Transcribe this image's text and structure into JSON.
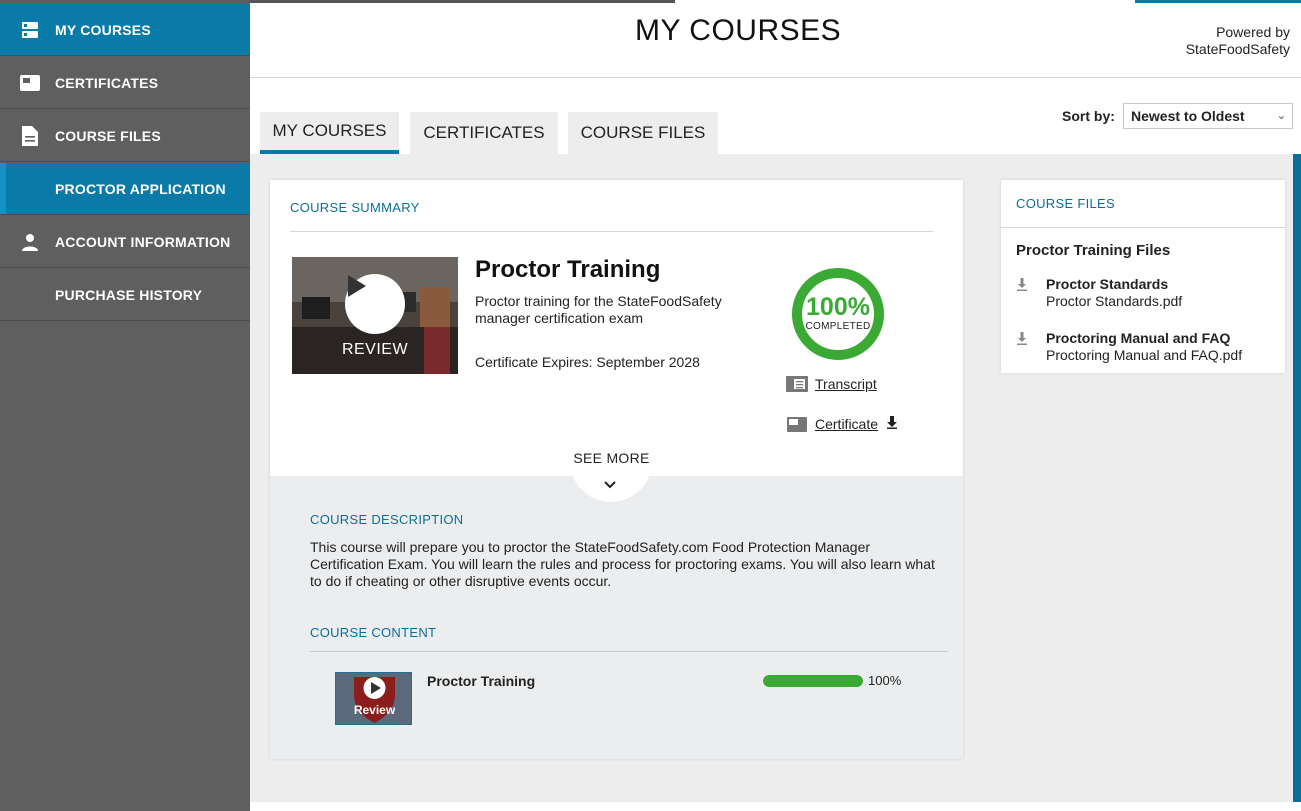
{
  "sidebar": {
    "items": [
      {
        "label": "MY COURSES",
        "icon": "courses-icon"
      },
      {
        "label": "CERTIFICATES",
        "icon": "certificate-card-icon"
      },
      {
        "label": "COURSE FILES",
        "icon": "document-icon"
      },
      {
        "label": "PROCTOR APPLICATION",
        "icon": ""
      },
      {
        "label": "ACCOUNT INFORMATION",
        "icon": "person-icon"
      },
      {
        "label": "PURCHASE HISTORY",
        "icon": ""
      }
    ]
  },
  "header": {
    "title": "MY COURSES",
    "powered_line1": "Powered by",
    "powered_line2": "StateFoodSafety"
  },
  "tabs": [
    {
      "label": "MY COURSES",
      "active": true
    },
    {
      "label": "CERTIFICATES",
      "active": false
    },
    {
      "label": "COURSE FILES",
      "active": false
    }
  ],
  "sort": {
    "label": "Sort by:",
    "value": "Newest to Oldest"
  },
  "course": {
    "summary_label": "COURSE SUMMARY",
    "thumbnail_label": "REVIEW",
    "title": "Proctor Training",
    "subtitle": "Proctor training for the StateFoodSafety manager certification exam",
    "expires": "Certificate Expires: September 2028",
    "progress_percent": "100%",
    "progress_fraction": 1.0,
    "progress_caption": "COMPLETED",
    "transcript_link": "Transcript",
    "certificate_link": "Certificate",
    "see_more": "SEE MORE",
    "description_label": "COURSE DESCRIPTION",
    "description": "This course will prepare you to proctor the StateFoodSafety.com Food Protection Manager Certification Exam. You will learn the rules and process for proctoring exams. You will also learn what to do if cheating or other disruptive events occur.",
    "content_label": "COURSE CONTENT",
    "modules": [
      {
        "title": "Proctor Training",
        "thumb_label": "Review",
        "percent": "100%",
        "fraction": 1.0
      }
    ]
  },
  "files": {
    "label": "COURSE FILES",
    "group": "Proctor Training Files",
    "items": [
      {
        "title": "Proctor Standards",
        "filename": "Proctor Standards.pdf"
      },
      {
        "title": "Proctoring Manual and FAQ",
        "filename": "Proctoring Manual and FAQ.pdf"
      }
    ]
  },
  "colors": {
    "accent": "#0a7aa8",
    "sidebar": "#5f5f5f",
    "success": "#3aaa35"
  }
}
